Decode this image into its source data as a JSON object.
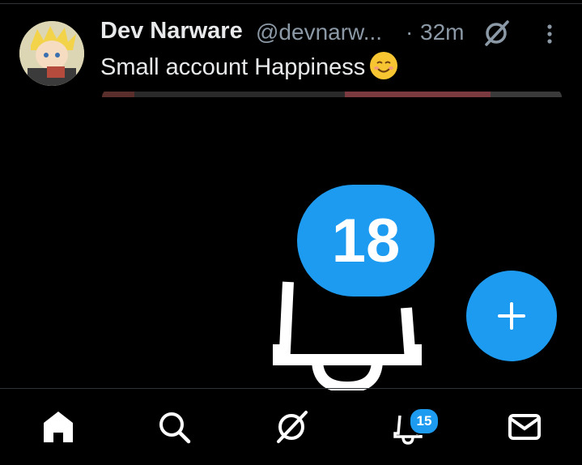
{
  "tweet": {
    "display_name": "Dev Narware",
    "handle": "@devnarw...",
    "separator": "·",
    "time_ago": "32m",
    "text": "Small account Happiness",
    "emoji": "smiling-face-icon"
  },
  "notification_overlay": {
    "count": "18"
  },
  "compose": {
    "icon": "plus-icon"
  },
  "bottom_nav": {
    "items": [
      {
        "name": "home",
        "icon": "home-icon"
      },
      {
        "name": "search",
        "icon": "search-icon"
      },
      {
        "name": "grok",
        "icon": "grok-icon"
      },
      {
        "name": "notifications",
        "icon": "bell-icon",
        "badge": "15"
      },
      {
        "name": "messages",
        "icon": "envelope-icon"
      }
    ]
  },
  "colors": {
    "background": "#000000",
    "accent": "#1d9bf0",
    "text_primary": "#e7e9ea",
    "text_secondary": "#8b98a5",
    "divider": "#2f3336"
  }
}
